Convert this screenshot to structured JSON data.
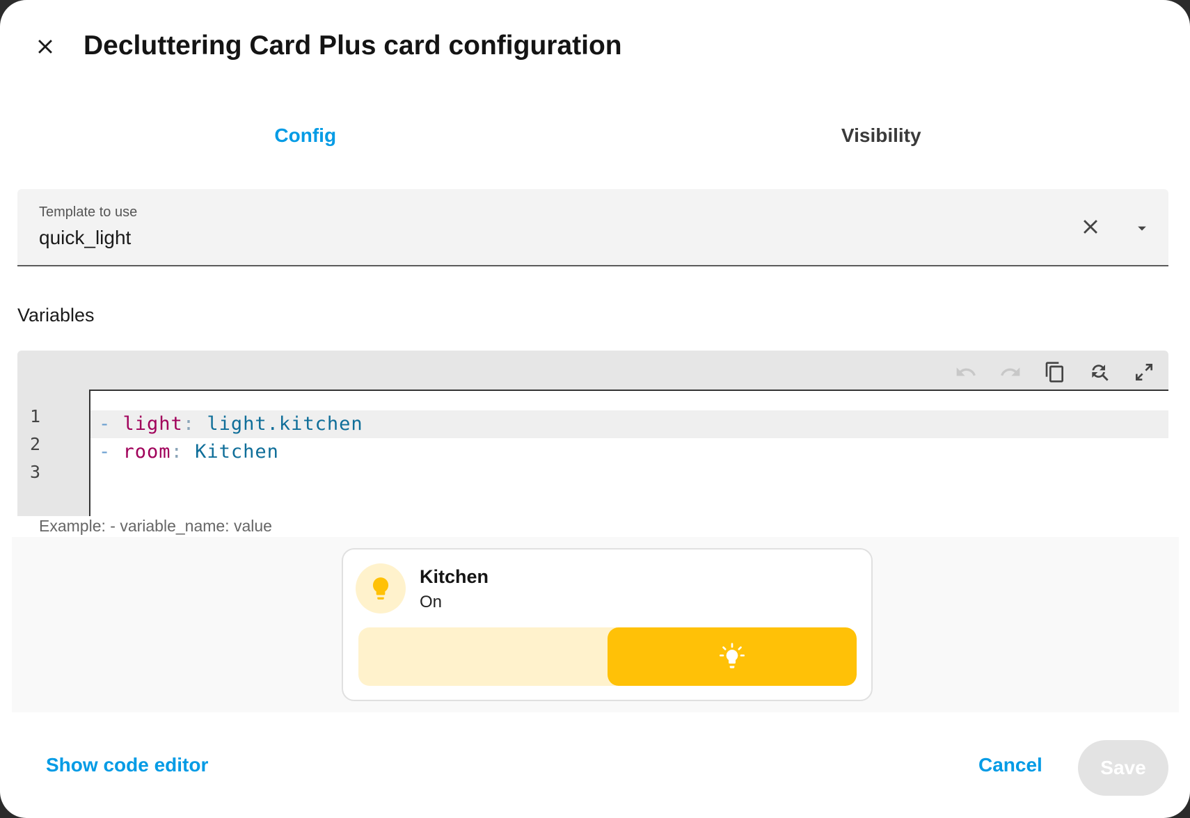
{
  "dialog": {
    "title": "Decluttering Card Plus card configuration",
    "close_icon": "close-icon"
  },
  "tabs": [
    {
      "label": "Config",
      "active": true
    },
    {
      "label": "Visibility",
      "active": false
    }
  ],
  "template_field": {
    "label": "Template to use",
    "value": "quick_light",
    "clear_icon": "close-icon",
    "dropdown_icon": "menu-down-icon"
  },
  "variables": {
    "label": "Variables",
    "toolbar": [
      "undo-icon",
      "redo-icon",
      "copy-icon",
      "find-replace-icon",
      "fullscreen-icon"
    ],
    "lines": [
      {
        "number": "1",
        "dash": "-",
        "key": "light",
        "colon": ":",
        "value": "light.kitchen"
      },
      {
        "number": "2",
        "dash": "-",
        "key": "room",
        "colon": ":",
        "value": "Kitchen"
      },
      {
        "number": "3",
        "dash": "",
        "key": "",
        "colon": "",
        "value": ""
      }
    ],
    "helper": "Example: - variable_name: value"
  },
  "preview_tile": {
    "name": "Kitchen",
    "state": "On",
    "icon": "lightbulb-icon",
    "slider_icon": "lightbulb-on-icon",
    "brightness_percent": 50,
    "accent_color": "#ffc107",
    "accent_light": "#fff2cc"
  },
  "footer": {
    "show_code_editor": "Show code editor",
    "cancel": "Cancel",
    "save": "Save"
  },
  "colors": {
    "primary": "#039be5",
    "background": "#ffffff"
  }
}
